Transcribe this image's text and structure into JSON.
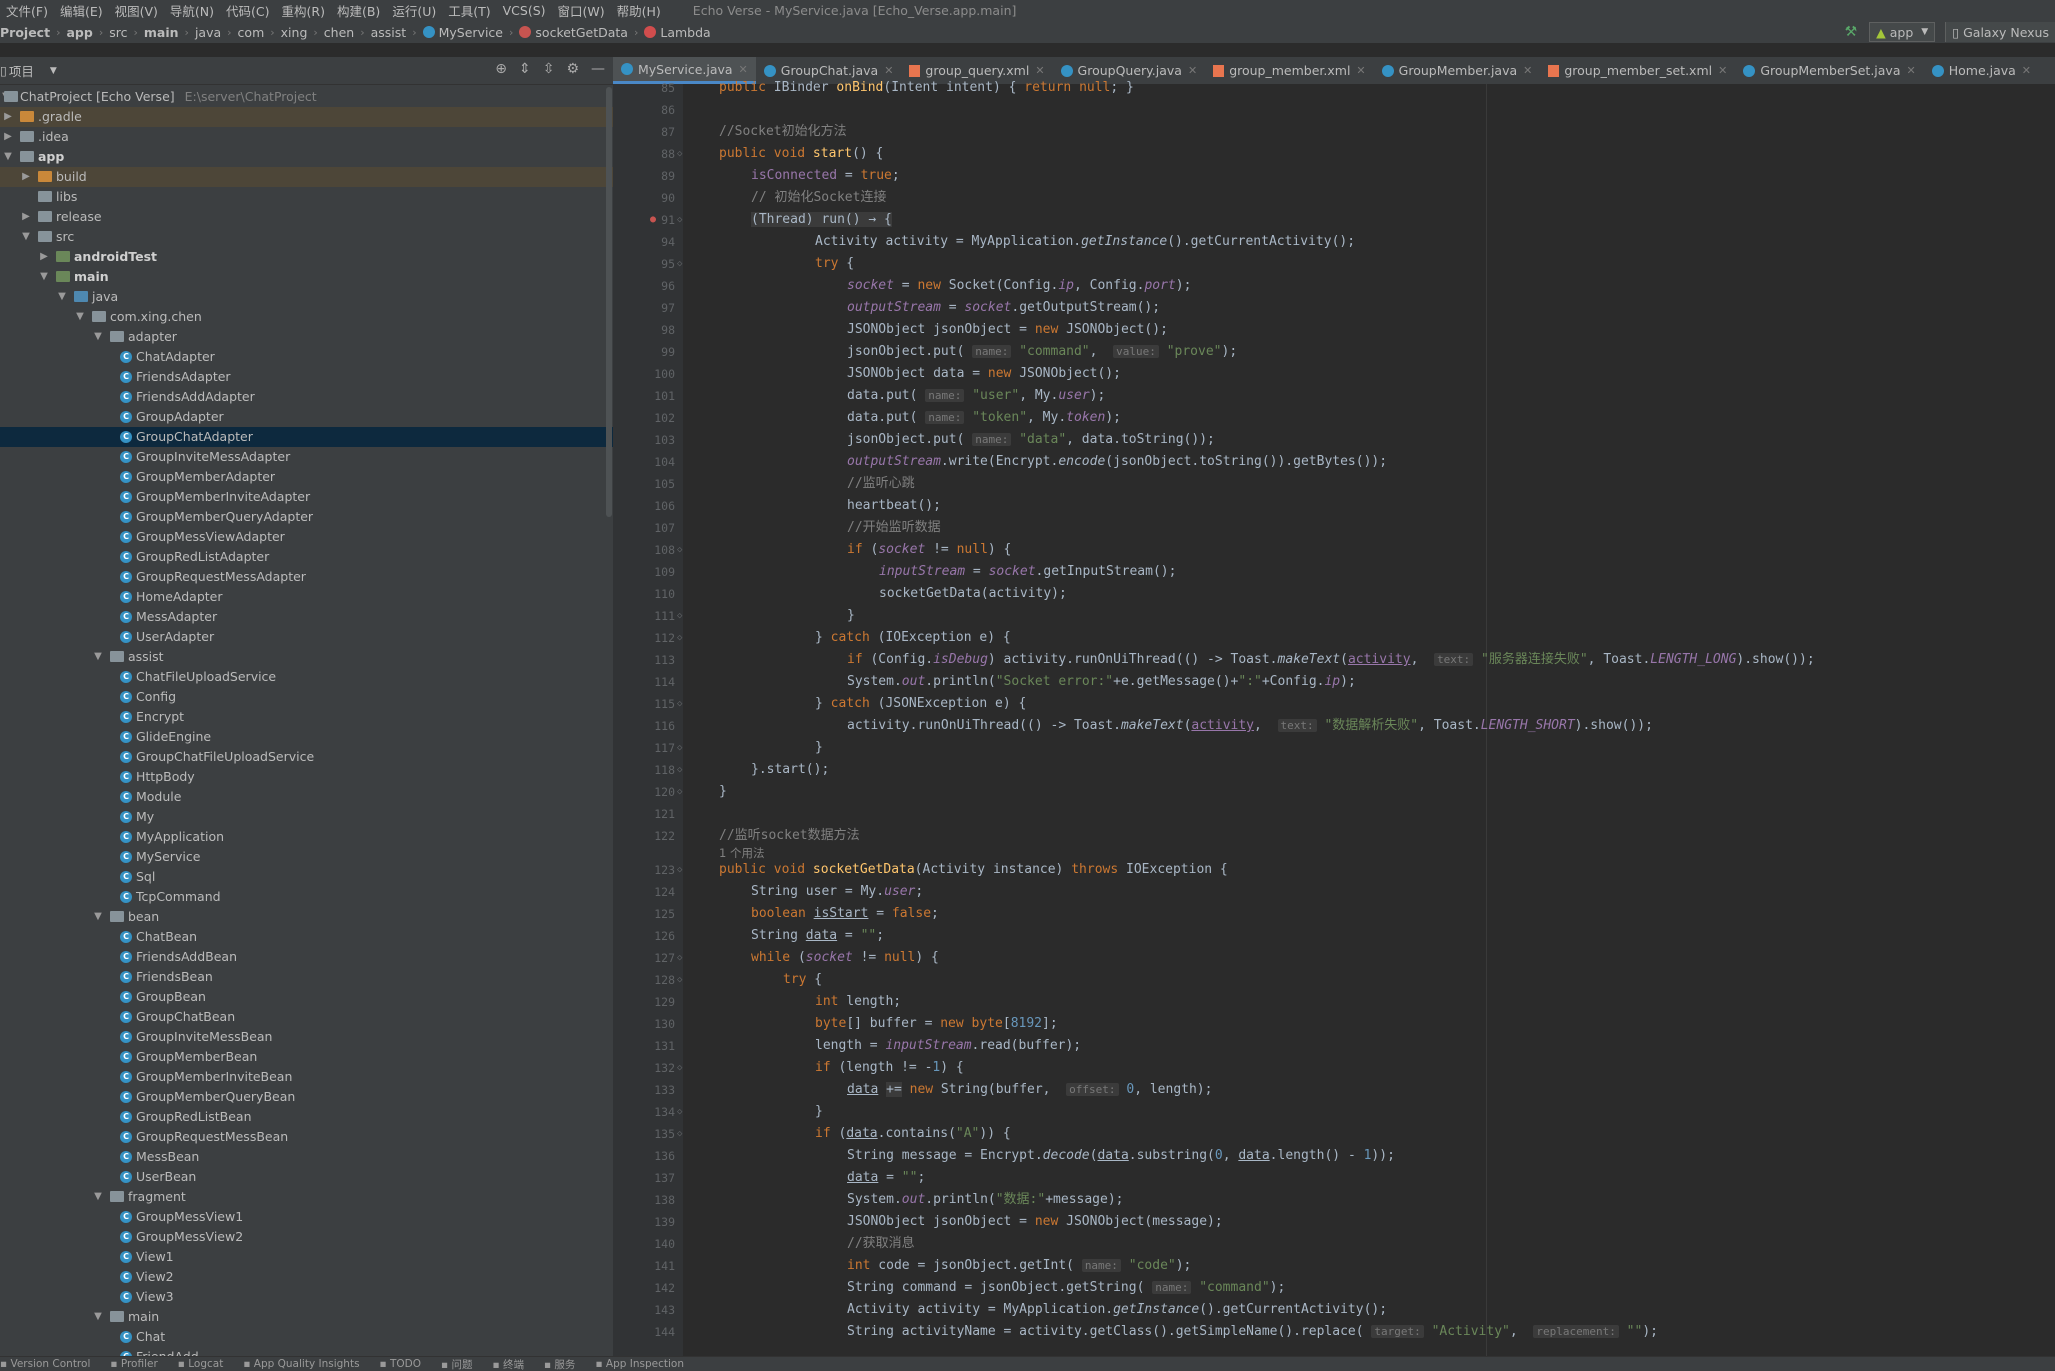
{
  "menu": [
    "文件(F)",
    "编辑(E)",
    "视图(V)",
    "导航(N)",
    "代码(C)",
    "重构(R)",
    "构建(B)",
    "运行(U)",
    "工具(T)",
    "VCS(S)",
    "窗口(W)",
    "帮助(H)"
  ],
  "window_title": "Echo Verse - MyService.java [Echo_Verse.app.main]",
  "breadcrumbs": [
    "Project",
    "app",
    "src",
    "main",
    "java",
    "com",
    "xing",
    "chen",
    "assist",
    "MyService",
    "socketGetData",
    "Lambda"
  ],
  "run_config": "app",
  "device": "Galaxy Nexus",
  "project_panel": {
    "title": "项目",
    "root_name": "ChatProject [Echo Verse]",
    "root_path": "E:\\server\\ChatProject"
  },
  "tree": [
    {
      "label": ".gradle",
      "depth": 0,
      "arrow": "right",
      "icon": "folder-orange",
      "hl": true
    },
    {
      "label": ".idea",
      "depth": 0,
      "arrow": "right",
      "icon": "folder"
    },
    {
      "label": "app",
      "depth": 0,
      "arrow": "down",
      "icon": "folder-module",
      "bold": true
    },
    {
      "label": "build",
      "depth": 1,
      "arrow": "right",
      "icon": "folder-orange",
      "hl": true
    },
    {
      "label": "libs",
      "depth": 1,
      "arrow": "",
      "icon": "folder"
    },
    {
      "label": "release",
      "depth": 1,
      "arrow": "right",
      "icon": "folder"
    },
    {
      "label": "src",
      "depth": 1,
      "arrow": "down",
      "icon": "folder"
    },
    {
      "label": "androidTest",
      "depth": 2,
      "arrow": "right",
      "icon": "folder-green",
      "bold": true
    },
    {
      "label": "main",
      "depth": 2,
      "arrow": "down",
      "icon": "folder-green",
      "bold": true
    },
    {
      "label": "java",
      "depth": 3,
      "arrow": "down",
      "icon": "folder-blue"
    },
    {
      "label": "com.xing.chen",
      "depth": 4,
      "arrow": "down",
      "icon": "folder"
    },
    {
      "label": "adapter",
      "depth": 5,
      "arrow": "down",
      "icon": "folder"
    },
    {
      "label": "ChatAdapter",
      "depth": 6,
      "icon": "class"
    },
    {
      "label": "FriendsAdapter",
      "depth": 6,
      "icon": "class"
    },
    {
      "label": "FriendsAddAdapter",
      "depth": 6,
      "icon": "class"
    },
    {
      "label": "GroupAdapter",
      "depth": 6,
      "icon": "class"
    },
    {
      "label": "GroupChatAdapter",
      "depth": 6,
      "icon": "class",
      "sel": true
    },
    {
      "label": "GroupInviteMessAdapter",
      "depth": 6,
      "icon": "class"
    },
    {
      "label": "GroupMemberAdapter",
      "depth": 6,
      "icon": "class"
    },
    {
      "label": "GroupMemberInviteAdapter",
      "depth": 6,
      "icon": "class"
    },
    {
      "label": "GroupMemberQueryAdapter",
      "depth": 6,
      "icon": "class"
    },
    {
      "label": "GroupMessViewAdapter",
      "depth": 6,
      "icon": "class"
    },
    {
      "label": "GroupRedListAdapter",
      "depth": 6,
      "icon": "class"
    },
    {
      "label": "GroupRequestMessAdapter",
      "depth": 6,
      "icon": "class"
    },
    {
      "label": "HomeAdapter",
      "depth": 6,
      "icon": "class"
    },
    {
      "label": "MessAdapter",
      "depth": 6,
      "icon": "class"
    },
    {
      "label": "UserAdapter",
      "depth": 6,
      "icon": "class"
    },
    {
      "label": "assist",
      "depth": 5,
      "arrow": "down",
      "icon": "folder"
    },
    {
      "label": "ChatFileUploadService",
      "depth": 6,
      "icon": "class"
    },
    {
      "label": "Config",
      "depth": 6,
      "icon": "class"
    },
    {
      "label": "Encrypt",
      "depth": 6,
      "icon": "class"
    },
    {
      "label": "GlideEngine",
      "depth": 6,
      "icon": "class"
    },
    {
      "label": "GroupChatFileUploadService",
      "depth": 6,
      "icon": "class"
    },
    {
      "label": "HttpBody",
      "depth": 6,
      "icon": "class"
    },
    {
      "label": "Module",
      "depth": 6,
      "icon": "class"
    },
    {
      "label": "My",
      "depth": 6,
      "icon": "class"
    },
    {
      "label": "MyApplication",
      "depth": 6,
      "icon": "class"
    },
    {
      "label": "MyService",
      "depth": 6,
      "icon": "class"
    },
    {
      "label": "Sql",
      "depth": 6,
      "icon": "class"
    },
    {
      "label": "TcpCommand",
      "depth": 6,
      "icon": "class"
    },
    {
      "label": "bean",
      "depth": 5,
      "arrow": "down",
      "icon": "folder"
    },
    {
      "label": "ChatBean",
      "depth": 6,
      "icon": "class"
    },
    {
      "label": "FriendsAddBean",
      "depth": 6,
      "icon": "class"
    },
    {
      "label": "FriendsBean",
      "depth": 6,
      "icon": "class"
    },
    {
      "label": "GroupBean",
      "depth": 6,
      "icon": "class"
    },
    {
      "label": "GroupChatBean",
      "depth": 6,
      "icon": "class"
    },
    {
      "label": "GroupInviteMessBean",
      "depth": 6,
      "icon": "class"
    },
    {
      "label": "GroupMemberBean",
      "depth": 6,
      "icon": "class"
    },
    {
      "label": "GroupMemberInviteBean",
      "depth": 6,
      "icon": "class"
    },
    {
      "label": "GroupMemberQueryBean",
      "depth": 6,
      "icon": "class"
    },
    {
      "label": "GroupRedListBean",
      "depth": 6,
      "icon": "class"
    },
    {
      "label": "GroupRequestMessBean",
      "depth": 6,
      "icon": "class"
    },
    {
      "label": "MessBean",
      "depth": 6,
      "icon": "class"
    },
    {
      "label": "UserBean",
      "depth": 6,
      "icon": "class"
    },
    {
      "label": "fragment",
      "depth": 5,
      "arrow": "down",
      "icon": "folder"
    },
    {
      "label": "GroupMessView1",
      "depth": 6,
      "icon": "class"
    },
    {
      "label": "GroupMessView2",
      "depth": 6,
      "icon": "class"
    },
    {
      "label": "View1",
      "depth": 6,
      "icon": "class"
    },
    {
      "label": "View2",
      "depth": 6,
      "icon": "class"
    },
    {
      "label": "View3",
      "depth": 6,
      "icon": "class"
    },
    {
      "label": "main",
      "depth": 5,
      "arrow": "down",
      "icon": "folder"
    },
    {
      "label": "Chat",
      "depth": 6,
      "icon": "class"
    },
    {
      "label": "FriendAdd",
      "depth": 6,
      "icon": "class"
    }
  ],
  "tabs": [
    {
      "label": "MyService.java",
      "icon": "class",
      "active": true
    },
    {
      "label": "GroupChat.java",
      "icon": "class"
    },
    {
      "label": "group_query.xml",
      "icon": "xml"
    },
    {
      "label": "GroupQuery.java",
      "icon": "class"
    },
    {
      "label": "group_member.xml",
      "icon": "xml"
    },
    {
      "label": "GroupMember.java",
      "icon": "class"
    },
    {
      "label": "group_member_set.xml",
      "icon": "xml"
    },
    {
      "label": "GroupMemberSet.java",
      "icon": "class"
    },
    {
      "label": "Home.java",
      "icon": "class"
    }
  ],
  "code_lines": [
    {
      "n": "85",
      "html": "<span class=\"k\">public</span> IBinder <span class=\"m\">onBind</span>(Intent intent) { <span class=\"k\">return null</span>; }",
      "indent": 0,
      "y": -7
    },
    {
      "n": "86",
      "html": "",
      "indent": 0
    },
    {
      "n": "87",
      "html": "<span class=\"c\">//Socket初始化方法</span>",
      "indent": 0
    },
    {
      "n": "88",
      "html": "<span class=\"k\">public void</span> <span class=\"m\">start</span>() {",
      "indent": 0,
      "fold": true
    },
    {
      "n": "89",
      "html": "<span class=\"f\">isConnected</span> = <span class=\"k\">true</span>;",
      "indent": 1
    },
    {
      "n": "90",
      "html": "<span class=\"c\">// 初始化Socket连接</span>",
      "indent": 1
    },
    {
      "n": "91",
      "html": "<span class=\"fold-box\">(Thread) run() → {</span>",
      "indent": 1,
      "fold": true,
      "bm": true
    },
    {
      "n": "94",
      "html": "Activity activity = MyApplication.<span class=\"it\">getInstance</span>().getCurrentActivity();",
      "indent": 3
    },
    {
      "n": "95",
      "html": "<span class=\"k\">try</span> {",
      "indent": 3,
      "fold": true
    },
    {
      "n": "96",
      "html": "<span class=\"fi\">socket</span> = <span class=\"k\">new</span> Socket(Config.<span class=\"fi\">ip</span>, Config.<span class=\"fi\">port</span>);",
      "indent": 4
    },
    {
      "n": "97",
      "html": "<span class=\"fi\">outputStream</span> = <span class=\"fi\">socket</span>.getOutputStream();",
      "indent": 4
    },
    {
      "n": "98",
      "html": "JSONObject jsonObject = <span class=\"k\">new</span> JSONObject();",
      "indent": 4
    },
    {
      "n": "99",
      "html": "jsonObject.put( <span class=\"h\">name:</span> <span class=\"s\">\"command\"</span>,  <span class=\"h\">value:</span> <span class=\"s\">\"prove\"</span>);",
      "indent": 4
    },
    {
      "n": "100",
      "html": "JSONObject data = <span class=\"k\">new</span> JSONObject();",
      "indent": 4
    },
    {
      "n": "101",
      "html": "data.put( <span class=\"h\">name:</span> <span class=\"s\">\"user\"</span>, My.<span class=\"fi\">user</span>);",
      "indent": 4
    },
    {
      "n": "102",
      "html": "data.put( <span class=\"h\">name:</span> <span class=\"s\">\"token\"</span>, My.<span class=\"fi\">token</span>);",
      "indent": 4
    },
    {
      "n": "103",
      "html": "jsonObject.put( <span class=\"h\">name:</span> <span class=\"s\">\"data\"</span>, data.toString());",
      "indent": 4
    },
    {
      "n": "104",
      "html": "<span class=\"fi\">outputStream</span>.write(Encrypt.<span class=\"it\">encode</span>(jsonObject.toString()).getBytes());",
      "indent": 4
    },
    {
      "n": "105",
      "html": "<span class=\"c\">//监听心跳</span>",
      "indent": 4
    },
    {
      "n": "106",
      "html": "heartbeat();",
      "indent": 4
    },
    {
      "n": "107",
      "html": "<span class=\"c\">//开始监听数据</span>",
      "indent": 4
    },
    {
      "n": "108",
      "html": "<span class=\"k\">if</span> (<span class=\"fi\">socket</span> != <span class=\"k\">null</span>) {",
      "indent": 4,
      "fold": true
    },
    {
      "n": "109",
      "html": "<span class=\"fi\">inputStream</span> = <span class=\"fi\">socket</span>.getInputStream();",
      "indent": 5
    },
    {
      "n": "110",
      "html": "socketGetData(activity);",
      "indent": 5
    },
    {
      "n": "111",
      "html": "}",
      "indent": 4,
      "fold": true
    },
    {
      "n": "112",
      "html": "} <span class=\"k\">catch</span> (IOException e) {",
      "indent": 3,
      "fold": true
    },
    {
      "n": "113",
      "html": "<span class=\"k\">if</span> (Config.<span class=\"fi\">isDebug</span>) activity.runOnUiThread(() -> Toast.<span class=\"it\">makeText</span>(<span class=\"f u\">activity</span>,  <span class=\"h\">text:</span> <span class=\"s\">\"服务器连接失败\"</span>, Toast.<span class=\"fi\">LENGTH_LONG</span>).show());",
      "indent": 4
    },
    {
      "n": "114",
      "html": "System.<span class=\"fi\">out</span>.println(<span class=\"s\">\"Socket error:\"</span>+e.getMessage()+<span class=\"s\">\":\"</span>+Config.<span class=\"fi\">ip</span>);",
      "indent": 4
    },
    {
      "n": "115",
      "html": "} <span class=\"k\">catch</span> (JSONException e) {",
      "indent": 3,
      "fold": true
    },
    {
      "n": "116",
      "html": "activity.runOnUiThread(() -> Toast.<span class=\"it\">makeText</span>(<span class=\"f u\">activity</span>,  <span class=\"h\">text:</span> <span class=\"s\">\"数据解析失败\"</span>, Toast.<span class=\"fi\">LENGTH_SHORT</span>).show());",
      "indent": 4
    },
    {
      "n": "117",
      "html": "}",
      "indent": 3,
      "fold": true
    },
    {
      "n": "118",
      "html": "}.start();",
      "indent": 1,
      "fold": true
    },
    {
      "n": "120",
      "html": "}",
      "indent": 0,
      "fold": true
    },
    {
      "n": "121",
      "html": "",
      "indent": 0
    },
    {
      "n": "122",
      "html": "<span class=\"c\">//监听socket数据方法</span>",
      "indent": 0
    },
    {
      "n": "",
      "html": "<span class=\"ul\">1 个用法</span>",
      "indent": 0,
      "usage": true
    },
    {
      "n": "123",
      "html": "<span class=\"k\">public void</span> <span class=\"m\">socketGetData</span>(Activity instance) <span class=\"k\">throws</span> IOException {",
      "indent": 0,
      "fold": true
    },
    {
      "n": "124",
      "html": "String user = My.<span class=\"fi\">user</span>;",
      "indent": 1
    },
    {
      "n": "125",
      "html": "<span class=\"k\">boolean</span> <span class=\"u\">isStart</span> = <span class=\"k\">false</span>;",
      "indent": 1
    },
    {
      "n": "126",
      "html": "String <span class=\"u\">data</span> = <span class=\"s\">\"\"</span>;",
      "indent": 1
    },
    {
      "n": "127",
      "html": "<span class=\"k\">while</span> (<span class=\"fi\">socket</span> != <span class=\"k\">null</span>) {",
      "indent": 1,
      "fold": true
    },
    {
      "n": "128",
      "html": "<span class=\"k\">try</span> {",
      "indent": 2,
      "fold": true
    },
    {
      "n": "129",
      "html": "<span class=\"k\">int</span> length;",
      "indent": 3
    },
    {
      "n": "130",
      "html": "<span class=\"k\">byte</span>[] buffer = <span class=\"k\">new byte</span>[<span class=\"n\">8192</span>];",
      "indent": 3
    },
    {
      "n": "131",
      "html": "length = <span class=\"fi\">inputStream</span>.read(buffer);",
      "indent": 3
    },
    {
      "n": "132",
      "html": "<span class=\"k\">if</span> (length != -<span class=\"n\">1</span>) {",
      "indent": 3,
      "fold": true
    },
    {
      "n": "133",
      "html": "<span class=\"u\">data</span> <span class=\"fold-box\">+=</span> <span class=\"k\">new</span> String(buffer,  <span class=\"h\">offset:</span> <span class=\"n\">0</span>, length);",
      "indent": 4
    },
    {
      "n": "134",
      "html": "}",
      "indent": 3,
      "fold": true
    },
    {
      "n": "135",
      "html": "<span class=\"k\">if</span> (<span class=\"u\">data</span>.contains(<span class=\"s\">\"A\"</span>)) {",
      "indent": 3,
      "fold": true
    },
    {
      "n": "136",
      "html": "String message = Encrypt.<span class=\"it\">decode</span>(<span class=\"u\">data</span>.substring(<span class=\"n\">0</span>, <span class=\"u\">data</span>.length() - <span class=\"n\">1</span>));",
      "indent": 4
    },
    {
      "n": "137",
      "html": "<span class=\"u\">data</span> = <span class=\"s\">\"\"</span>;",
      "indent": 4
    },
    {
      "n": "138",
      "html": "System.<span class=\"fi\">out</span>.println(<span class=\"s\">\"数据:\"</span>+message);",
      "indent": 4
    },
    {
      "n": "139",
      "html": "JSONObject jsonObject = <span class=\"k\">new</span> JSONObject(message);",
      "indent": 4
    },
    {
      "n": "140",
      "html": "<span class=\"c\">//获取消息</span>",
      "indent": 4
    },
    {
      "n": "141",
      "html": "<span class=\"k\">int</span> code = jsonObject.getInt( <span class=\"h\">name:</span> <span class=\"s\">\"code\"</span>);",
      "indent": 4
    },
    {
      "n": "142",
      "html": "String command = jsonObject.getString( <span class=\"h\">name:</span> <span class=\"s\">\"command\"</span>);",
      "indent": 4
    },
    {
      "n": "143",
      "html": "Activity activity = MyApplication.<span class=\"it\">getInstance</span>().getCurrentActivity();",
      "indent": 4
    },
    {
      "n": "144",
      "html": "String activityName = activity.getClass().getSimpleName().replace( <span class=\"h\">target:</span> <span class=\"s\">\"Activity\"</span>,  <span class=\"h\">replacement:</span> <span class=\"s\">\"\"</span>);",
      "indent": 4
    }
  ],
  "status_items": [
    "Version Control",
    "Profiler",
    "Logcat",
    "App Quality Insights",
    "TODO",
    "问题",
    "终端",
    "服务",
    "App Inspection"
  ],
  "colors": {
    "accent": "#4a88c7",
    "keyword": "#cc7832",
    "string": "#6a8759",
    "field": "#9876aa",
    "method": "#ffc66d",
    "number": "#6897bb",
    "comment": "#808080"
  }
}
